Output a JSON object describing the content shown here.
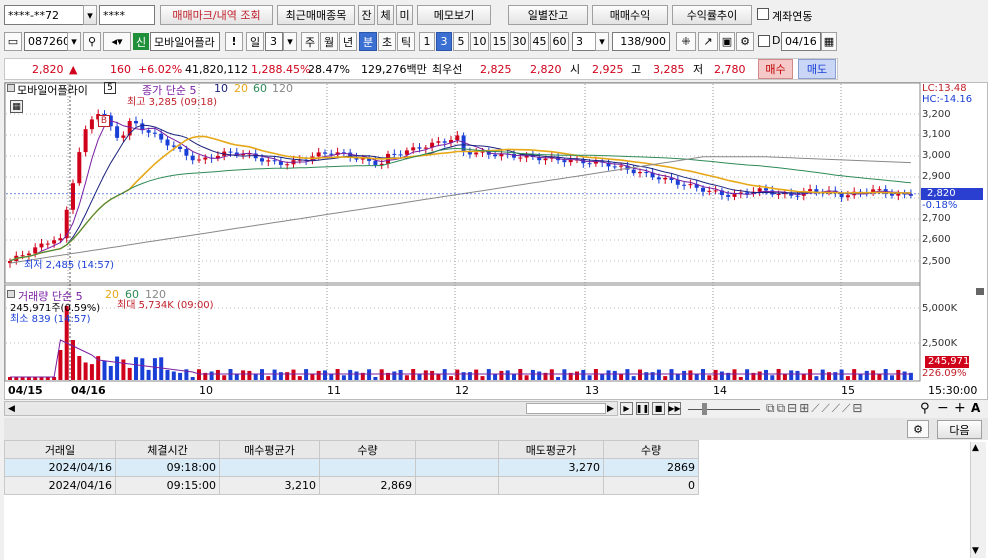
{
  "toolbar1": {
    "account": "****-**72",
    "password": "****",
    "btn_marks": "매매마크/내역 조회",
    "btn_recent": "최근매매종목",
    "btn_jan": "잔",
    "btn_che": "체",
    "btn_mi": "미",
    "btn_memo": "메모보기",
    "btn_daily": "일별잔고",
    "btn_profit": "매매수익",
    "btn_trend": "수익률추이",
    "chk_link": "계좌연동"
  },
  "toolbar2": {
    "code": "087260",
    "stock_tag": "신",
    "stock_name": "모바일어플라",
    "bang": "!",
    "period_il": "일",
    "period_num": "3",
    "p_ju": "주",
    "p_wol": "월",
    "p_nyeon": "년",
    "p_bun": "분",
    "p_cho": "초",
    "p_tik": "틱",
    "mins": [
      "1",
      "3",
      "5",
      "10",
      "15",
      "30",
      "45",
      "60"
    ],
    "selected_min": "3",
    "combo": "3",
    "count": "138",
    "count_total": "/900",
    "chk_d": "D",
    "date": "04/16"
  },
  "quote": {
    "price": "2,820",
    "arrow": "▲",
    "change": "160",
    "rate": "+6.02%",
    "volume": "41,820,112",
    "vol_rate": "1,288.45%",
    "turnover": "28.47%",
    "amount": "129,276백만",
    "priority_label": "최우선",
    "ask": "2,825",
    "bid": "2,820",
    "open_label": "시",
    "open": "2,925",
    "high_label": "고",
    "high": "3,285",
    "low_label": "저",
    "low": "2,780",
    "buy": "매수",
    "sell": "매도"
  },
  "price_panel": {
    "name": "모바일어플라이",
    "sub": "5",
    "legend_close": "종가 단순 5",
    "ma": [
      "10",
      "20",
      "60",
      "120"
    ],
    "high_note": "최고 3,285 (09:18)",
    "low_note": "최저 2,485 (14:57)",
    "lc": "LC:13.48",
    "hc": "HC:-14.16",
    "yticks": [
      "3,200",
      "3,100",
      "3,000",
      "2,900",
      "2,800",
      "2,700",
      "2,600",
      "2,500"
    ],
    "cur_price": "2,820",
    "cur_rate": "-0.18%",
    "marker_b": "B"
  },
  "volume_panel": {
    "legend": "거래량 단순 5",
    "ma": [
      "20",
      "60",
      "120"
    ],
    "max_note": "최대 5,734K (09:00)",
    "cur_note": "245,971주(0.59%)",
    "min_note": "최소 839 (14:57)",
    "yticks": [
      "5,000K",
      "2,500K"
    ],
    "cur_vol": "245,971",
    "cur_pct": "226.09%"
  },
  "xaxis": {
    "labels": [
      "04/15",
      "04/16",
      "10",
      "11",
      "12",
      "13",
      "14",
      "15"
    ],
    "end_time": "15:30:00"
  },
  "bottom": {
    "next": "다음",
    "columns": [
      "거래일",
      "체결시간",
      "매수평균가",
      "수량",
      "",
      "매도평균가",
      "수량"
    ],
    "rows": [
      [
        "2024/04/16",
        "09:18:00",
        "",
        "",
        "",
        "3,270",
        "2869"
      ],
      [
        "2024/04/16",
        "09:15:00",
        "3,210",
        "2,869",
        "",
        "",
        "0"
      ]
    ]
  },
  "colors": {
    "up": "#d0021b",
    "down": "#1a3fd6",
    "ma5": "#7a1fa2",
    "ma10": "#1a237e",
    "ma20": "#e6a817",
    "ma60": "#2e8b57",
    "ma120": "#888888"
  }
}
